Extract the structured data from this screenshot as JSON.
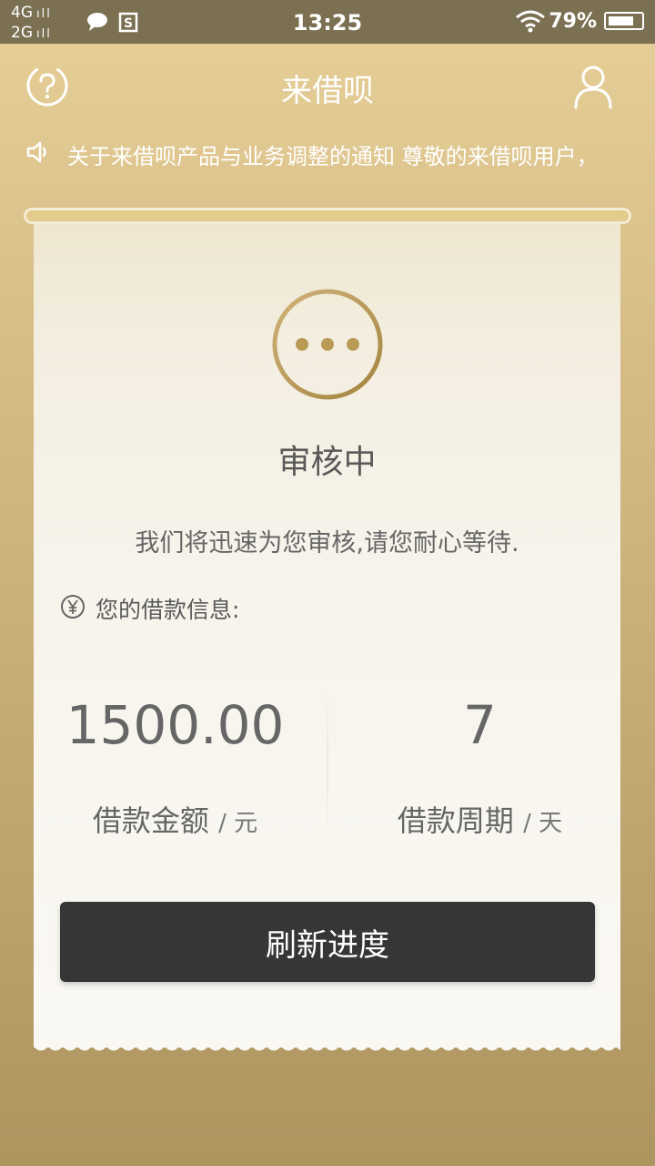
{
  "status_bar": {
    "network_top": "4G",
    "network_bottom": "2G",
    "time": "13:25",
    "battery": "79%",
    "battery_level": 0.79,
    "icons": [
      "signal-bars-icon",
      "chat-bubble-icon",
      "s-app-icon",
      "wifi-icon",
      "battery-icon"
    ]
  },
  "header": {
    "title": "来借呗",
    "left_icon": "help-circle-icon",
    "right_icon": "user-icon"
  },
  "notice": {
    "icon": "speaker-icon",
    "text": "关于来借呗产品与业务调整的通知 尊敬的来借呗用户，"
  },
  "card": {
    "status_icon": "pending-dots-icon",
    "status": "审核中",
    "message": "我们将迅速为您审核,请您耐心等待.",
    "info_icon": "yen-icon",
    "info_label": "您的借款信息:",
    "amount": "1500.00",
    "amount_label": "借款金额",
    "amount_unit": "/ 元",
    "period": "7",
    "period_label": "借款周期",
    "period_unit": "/ 天",
    "refresh_button": "刷新进度"
  },
  "colors": {
    "accent_gold": "#b89a55",
    "button_dark": "#363636",
    "status_bar": "#7b7052"
  }
}
